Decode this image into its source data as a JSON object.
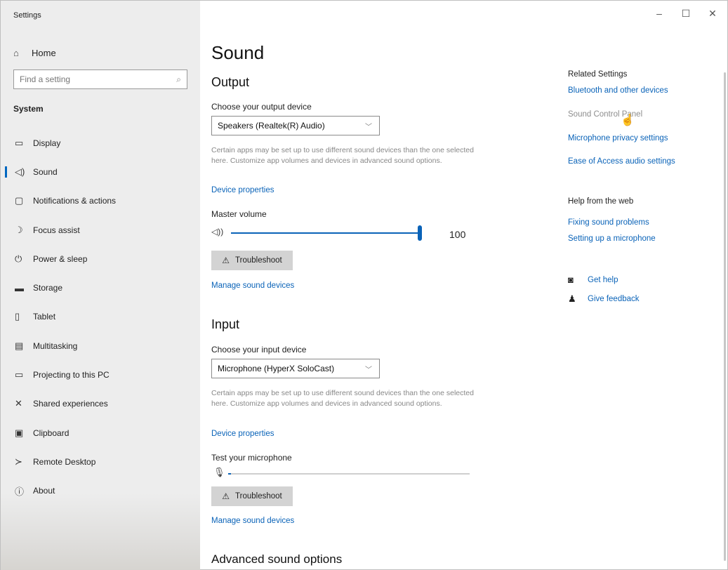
{
  "window": {
    "title": "Settings",
    "controls": {
      "minimize": "–",
      "maximize": "☐",
      "close": "✕"
    }
  },
  "sidebar": {
    "home": {
      "icon": "home-icon",
      "label": "Home"
    },
    "search": {
      "placeholder": "Find a setting",
      "icon": "search-icon"
    },
    "section": "System",
    "items": [
      {
        "label": "Display",
        "icon": "monitor-icon",
        "active": false
      },
      {
        "label": "Sound",
        "icon": "speaker-icon",
        "active": true
      },
      {
        "label": "Notifications & actions",
        "icon": "notification-icon",
        "active": false
      },
      {
        "label": "Focus assist",
        "icon": "moon-icon",
        "active": false
      },
      {
        "label": "Power & sleep",
        "icon": "power-icon",
        "active": false
      },
      {
        "label": "Storage",
        "icon": "storage-icon",
        "active": false
      },
      {
        "label": "Tablet",
        "icon": "tablet-icon",
        "active": false
      },
      {
        "label": "Multitasking",
        "icon": "multitasking-icon",
        "active": false
      },
      {
        "label": "Projecting to this PC",
        "icon": "projector-icon",
        "active": false
      },
      {
        "label": "Shared experiences",
        "icon": "shared-icon",
        "active": false
      },
      {
        "label": "Clipboard",
        "icon": "clipboard-icon",
        "active": false
      },
      {
        "label": "Remote Desktop",
        "icon": "remote-desktop-icon",
        "active": false
      },
      {
        "label": "About",
        "icon": "info-icon",
        "active": false
      }
    ]
  },
  "main": {
    "title": "Sound",
    "output": {
      "heading": "Output",
      "device_label": "Choose your output device",
      "device_value": "Speakers (Realtek(R) Audio)",
      "description": "Certain apps may be set up to use different sound devices than the one selected here. Customize app volumes and devices in advanced sound options.",
      "device_properties": "Device properties",
      "volume_label": "Master volume",
      "volume_value": "100",
      "volume_level": 1.0,
      "troubleshoot": "Troubleshoot",
      "manage": "Manage sound devices"
    },
    "input": {
      "heading": "Input",
      "device_label": "Choose your input device",
      "device_value": "Microphone (HyperX SoloCast)",
      "description": "Certain apps may be set up to use different sound devices than the one selected here. Customize app volumes and devices in advanced sound options.",
      "device_properties": "Device properties",
      "test_label": "Test your microphone",
      "mic_level": 0.01,
      "troubleshoot": "Troubleshoot",
      "manage": "Manage sound devices"
    },
    "advanced": "Advanced sound options"
  },
  "right": {
    "related_heading": "Related Settings",
    "related_links": [
      "Bluetooth and other devices",
      "Sound Control Panel",
      "Microphone privacy settings",
      "Ease of Access audio settings"
    ],
    "help_heading": "Help from the web",
    "help_links": [
      "Fixing sound problems",
      "Setting up a microphone"
    ],
    "get_help": "Get help",
    "give_feedback": "Give feedback"
  },
  "colors": {
    "accent": "#0a63b8",
    "sidebar_bg": "#ededed",
    "button_bg": "#d3d3d3"
  }
}
